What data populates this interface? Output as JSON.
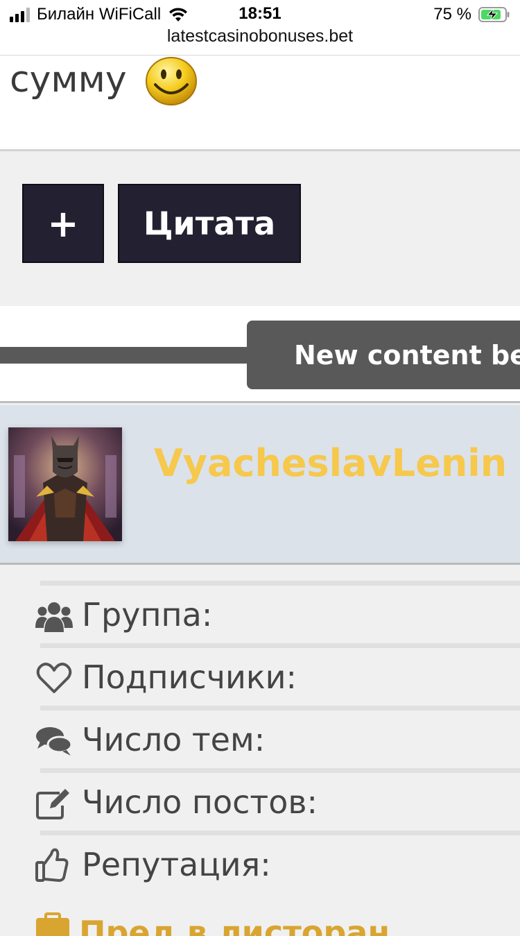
{
  "status_bar": {
    "carrier": "Билайн WiFiCall",
    "time": "18:51",
    "battery_percent": "75 %",
    "url": "latestcasinobonuses.bet",
    "icons": [
      "signal-icon",
      "wifi-icon",
      "battery-charging-icon"
    ]
  },
  "post": {
    "text": "сумму",
    "emoji": "smiley-icon"
  },
  "buttons": {
    "multiquote_label": "+",
    "quote_label": "Цитата"
  },
  "banner": {
    "text": "New content be"
  },
  "author": {
    "name": "VyacheslavLenin",
    "name_color": "#f6c84c"
  },
  "stats": [
    {
      "label": "Группа:",
      "icon": "users-icon"
    },
    {
      "label": "Подписчики:",
      "icon": "heart-icon"
    },
    {
      "label": "Число тем:",
      "icon": "comments-icon"
    },
    {
      "label": "Число постов:",
      "icon": "edit-icon"
    },
    {
      "label": "Репутация:",
      "icon": "thumbs-up-icon"
    }
  ],
  "peek": {
    "text": "Пред в листоран",
    "icon": "briefcase-icon",
    "color": "#d9a531"
  },
  "colors": {
    "button_bg": "#232131",
    "banner_bg": "#595959",
    "author_bg": "#dbe2ea"
  }
}
